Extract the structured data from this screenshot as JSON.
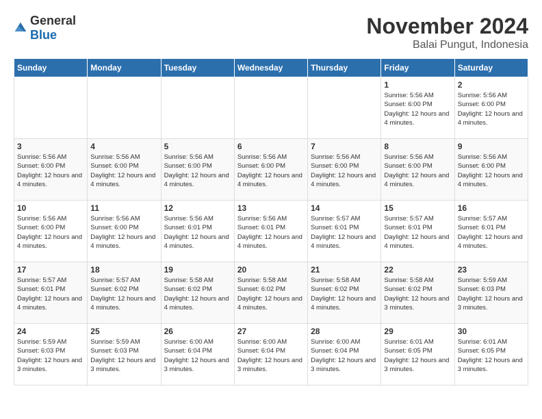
{
  "logo": {
    "general": "General",
    "blue": "Blue"
  },
  "header": {
    "month": "November 2024",
    "location": "Balai Pungut, Indonesia"
  },
  "weekdays": [
    "Sunday",
    "Monday",
    "Tuesday",
    "Wednesday",
    "Thursday",
    "Friday",
    "Saturday"
  ],
  "weeks": [
    [
      {
        "day": "",
        "info": ""
      },
      {
        "day": "",
        "info": ""
      },
      {
        "day": "",
        "info": ""
      },
      {
        "day": "",
        "info": ""
      },
      {
        "day": "",
        "info": ""
      },
      {
        "day": "1",
        "info": "Sunrise: 5:56 AM\nSunset: 6:00 PM\nDaylight: 12 hours and 4 minutes."
      },
      {
        "day": "2",
        "info": "Sunrise: 5:56 AM\nSunset: 6:00 PM\nDaylight: 12 hours and 4 minutes."
      }
    ],
    [
      {
        "day": "3",
        "info": "Sunrise: 5:56 AM\nSunset: 6:00 PM\nDaylight: 12 hours and 4 minutes."
      },
      {
        "day": "4",
        "info": "Sunrise: 5:56 AM\nSunset: 6:00 PM\nDaylight: 12 hours and 4 minutes."
      },
      {
        "day": "5",
        "info": "Sunrise: 5:56 AM\nSunset: 6:00 PM\nDaylight: 12 hours and 4 minutes."
      },
      {
        "day": "6",
        "info": "Sunrise: 5:56 AM\nSunset: 6:00 PM\nDaylight: 12 hours and 4 minutes."
      },
      {
        "day": "7",
        "info": "Sunrise: 5:56 AM\nSunset: 6:00 PM\nDaylight: 12 hours and 4 minutes."
      },
      {
        "day": "8",
        "info": "Sunrise: 5:56 AM\nSunset: 6:00 PM\nDaylight: 12 hours and 4 minutes."
      },
      {
        "day": "9",
        "info": "Sunrise: 5:56 AM\nSunset: 6:00 PM\nDaylight: 12 hours and 4 minutes."
      }
    ],
    [
      {
        "day": "10",
        "info": "Sunrise: 5:56 AM\nSunset: 6:00 PM\nDaylight: 12 hours and 4 minutes."
      },
      {
        "day": "11",
        "info": "Sunrise: 5:56 AM\nSunset: 6:00 PM\nDaylight: 12 hours and 4 minutes."
      },
      {
        "day": "12",
        "info": "Sunrise: 5:56 AM\nSunset: 6:01 PM\nDaylight: 12 hours and 4 minutes."
      },
      {
        "day": "13",
        "info": "Sunrise: 5:56 AM\nSunset: 6:01 PM\nDaylight: 12 hours and 4 minutes."
      },
      {
        "day": "14",
        "info": "Sunrise: 5:57 AM\nSunset: 6:01 PM\nDaylight: 12 hours and 4 minutes."
      },
      {
        "day": "15",
        "info": "Sunrise: 5:57 AM\nSunset: 6:01 PM\nDaylight: 12 hours and 4 minutes."
      },
      {
        "day": "16",
        "info": "Sunrise: 5:57 AM\nSunset: 6:01 PM\nDaylight: 12 hours and 4 minutes."
      }
    ],
    [
      {
        "day": "17",
        "info": "Sunrise: 5:57 AM\nSunset: 6:01 PM\nDaylight: 12 hours and 4 minutes."
      },
      {
        "day": "18",
        "info": "Sunrise: 5:57 AM\nSunset: 6:02 PM\nDaylight: 12 hours and 4 minutes."
      },
      {
        "day": "19",
        "info": "Sunrise: 5:58 AM\nSunset: 6:02 PM\nDaylight: 12 hours and 4 minutes."
      },
      {
        "day": "20",
        "info": "Sunrise: 5:58 AM\nSunset: 6:02 PM\nDaylight: 12 hours and 4 minutes."
      },
      {
        "day": "21",
        "info": "Sunrise: 5:58 AM\nSunset: 6:02 PM\nDaylight: 12 hours and 4 minutes."
      },
      {
        "day": "22",
        "info": "Sunrise: 5:58 AM\nSunset: 6:02 PM\nDaylight: 12 hours and 3 minutes."
      },
      {
        "day": "23",
        "info": "Sunrise: 5:59 AM\nSunset: 6:03 PM\nDaylight: 12 hours and 3 minutes."
      }
    ],
    [
      {
        "day": "24",
        "info": "Sunrise: 5:59 AM\nSunset: 6:03 PM\nDaylight: 12 hours and 3 minutes."
      },
      {
        "day": "25",
        "info": "Sunrise: 5:59 AM\nSunset: 6:03 PM\nDaylight: 12 hours and 3 minutes."
      },
      {
        "day": "26",
        "info": "Sunrise: 6:00 AM\nSunset: 6:04 PM\nDaylight: 12 hours and 3 minutes."
      },
      {
        "day": "27",
        "info": "Sunrise: 6:00 AM\nSunset: 6:04 PM\nDaylight: 12 hours and 3 minutes."
      },
      {
        "day": "28",
        "info": "Sunrise: 6:00 AM\nSunset: 6:04 PM\nDaylight: 12 hours and 3 minutes."
      },
      {
        "day": "29",
        "info": "Sunrise: 6:01 AM\nSunset: 6:05 PM\nDaylight: 12 hours and 3 minutes."
      },
      {
        "day": "30",
        "info": "Sunrise: 6:01 AM\nSunset: 6:05 PM\nDaylight: 12 hours and 3 minutes."
      }
    ]
  ]
}
